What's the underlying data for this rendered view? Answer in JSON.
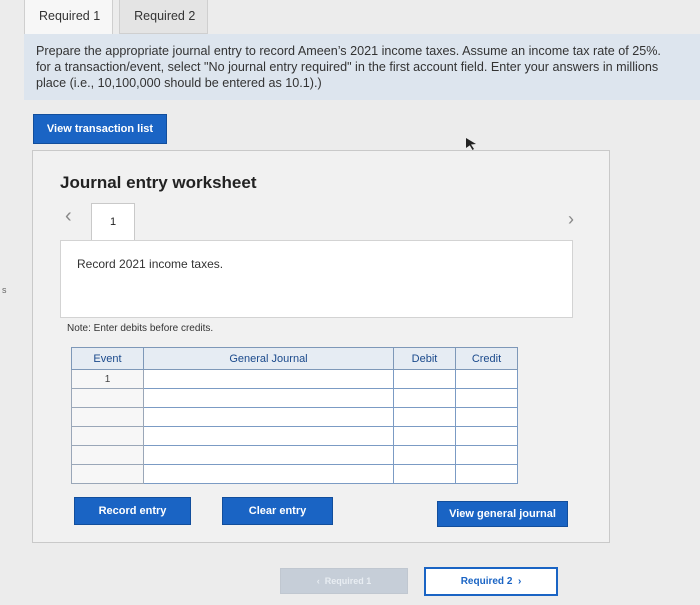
{
  "tabs": [
    {
      "label": "Required 1",
      "active": true
    },
    {
      "label": "Required 2",
      "active": false
    }
  ],
  "instructions": "Prepare the appropriate journal entry to record Ameen’s 2021 income taxes. Assume an income tax rate of 25%.\nfor a transaction/event, select \"No journal entry required\" in the first account field. Enter your answers in millions\nplace (i.e., 10,100,000 should be entered as 10.1).)",
  "buttons": {
    "view_transaction": "View transaction list",
    "record_entry": "Record entry",
    "clear_entry": "Clear entry",
    "view_journal": "View general journal",
    "prev_required": "Required 1",
    "next_required": "Required 2"
  },
  "worksheet": {
    "title": "Journal entry worksheet",
    "entry_number": "1",
    "description": "Record 2021 income taxes.",
    "note": "Note: Enter debits before credits."
  },
  "table": {
    "headers": [
      "Event",
      "General Journal",
      "Debit",
      "Credit"
    ],
    "rows": [
      {
        "event": "1"
      },
      {
        "event": ""
      },
      {
        "event": ""
      },
      {
        "event": ""
      },
      {
        "event": ""
      },
      {
        "event": ""
      }
    ]
  },
  "icons": {
    "prev": "chevron-left-icon",
    "next": "chevron-right-icon",
    "cursor": "mouse-cursor-icon"
  },
  "colors": {
    "accent": "#1a64c4",
    "instruction_bg": "#dde5ee",
    "disabled": "#c6ced8"
  },
  "edge_text": "s"
}
